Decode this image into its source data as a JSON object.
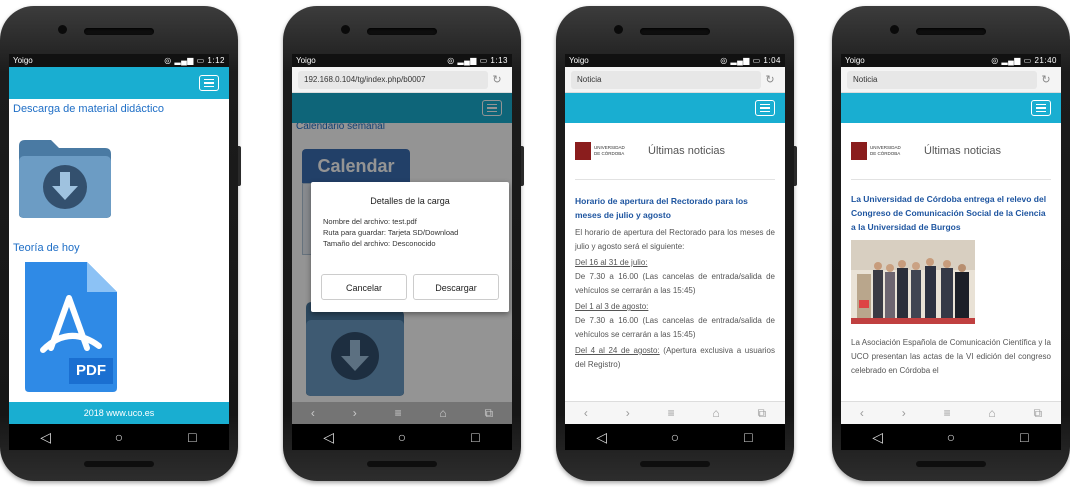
{
  "phone1": {
    "status_left": "Yoigo",
    "status_right": "1:12",
    "section1_title": "Descarga de material didáctico",
    "section2_title": "Teoría de hoy",
    "pdf_label": "PDF",
    "footer": "2018 www.uco.es"
  },
  "phone2": {
    "status_left": "Yoigo",
    "status_right": "1:13",
    "url": "192.168.0.104/tg/index.php/b0007",
    "bg_heading": "Calendario semanal",
    "calendar_label": "Calendar",
    "dialog": {
      "title": "Detalles de la carga",
      "line1": "Nombre del archivo: test.pdf",
      "line2": "Ruta para guardar: Tarjeta SD/Download",
      "line3": "Tamaño del archivo: Desconocido",
      "cancel": "Cancelar",
      "confirm": "Descargar"
    }
  },
  "phone3": {
    "status_left": "Yoigo",
    "status_right": "1:04",
    "url": "Noticia",
    "logo_text": "UNIVERSIDAD DE CÓRDOBA",
    "heading": "Últimas noticias",
    "news_title": "Horario de apertura del Rectorado para los meses de julio y agosto",
    "intro": "El horario de apertura del Rectorado para los meses de julio y agosto será el siguiente:",
    "p1_date": "Del 16 al 31 de julio:",
    "p1_text": "De 7.30 a 16.00 (Las cancelas de entrada/salida de vehículos se cerrarán a las 15:45)",
    "p2_date": "Del 1 al 3 de agosto:",
    "p2_text": "De 7.30 a 16.00 (Las cancelas de entrada/salida de vehículos se cerrarán a las 15:45)",
    "p3_date": "Del 4 al 24 de agosto:",
    "p3_text": " (Apertura exclusiva a usuarios del Registro)"
  },
  "phone4": {
    "status_left": "Yoigo",
    "status_right": "21:40",
    "url": "Noticia",
    "logo_text": "UNIVERSIDAD DE CÓRDOBA",
    "heading": "Últimas noticias",
    "news_title": "La Universidad de Córdoba entrega el relevo del Congreso de Comunicación Social de la Ciencia a la Universidad de Burgos",
    "body": "La Asociación Española de Comunicación Científica y la UCO presentan las actas de la VI edición del congreso celebrado en Córdoba el"
  },
  "colors": {
    "teal": "#19aed1",
    "title_blue": "#1e55a0",
    "folder": "#5b8fb8",
    "pdf_blue": "#2f8ae6"
  }
}
